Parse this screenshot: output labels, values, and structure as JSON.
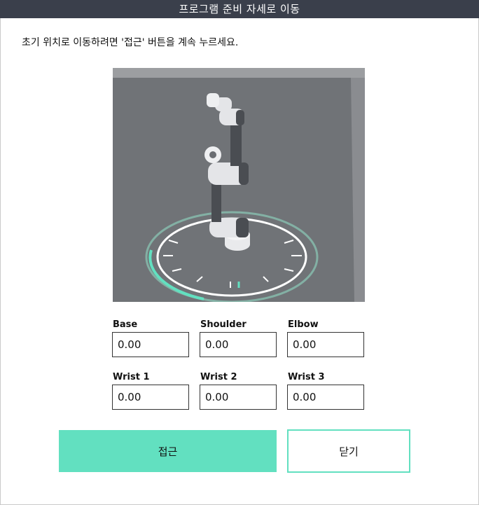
{
  "title": "프로그램 준비 자세로 이동",
  "instruction": "초기 위치로 이동하려면 '접근' 버튼을 계속 누르세요.",
  "joints": [
    {
      "label": "Base",
      "value": "0.00"
    },
    {
      "label": "Shoulder",
      "value": "0.00"
    },
    {
      "label": "Elbow",
      "value": "0.00"
    },
    {
      "label": "Wrist 1",
      "value": "0.00"
    },
    {
      "label": "Wrist 2",
      "value": "0.00"
    },
    {
      "label": "Wrist 3",
      "value": "0.00"
    }
  ],
  "buttons": {
    "approach": "접근",
    "close": "닫기"
  },
  "colors": {
    "title_bar": "#3a3f4b",
    "accent": "#62e0c0",
    "viewport_bg": "#6e7175"
  }
}
